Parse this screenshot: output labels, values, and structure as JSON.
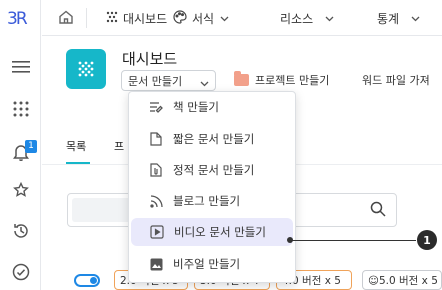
{
  "sidebar": {
    "logo": "3R",
    "notification_count": "1",
    "icons": [
      "menu-icon",
      "apps-grid-icon",
      "bell-icon",
      "star-icon",
      "history-icon",
      "check-circle-icon"
    ]
  },
  "topnav": {
    "items": [
      {
        "label": "대시보드",
        "icon": "dots-grid-icon"
      },
      {
        "label": "서식",
        "icon": "palette-icon"
      },
      {
        "label": "리소스"
      },
      {
        "label": "통계"
      }
    ]
  },
  "header": {
    "title": "대시보드",
    "doc_dropdown_label": "문서 만들기",
    "project_button": "프로젝트 만들기",
    "word_button": "워드 파일 가져"
  },
  "tabs": [
    {
      "label": "목록"
    },
    {
      "label": "프"
    }
  ],
  "menu": {
    "items": [
      {
        "label": "책 만들기",
        "icon": "book-icon"
      },
      {
        "label": "짧은 문서 만들기",
        "icon": "file-icon"
      },
      {
        "label": "정적 문서 만들기",
        "icon": "attachment-file-icon"
      },
      {
        "label": "블로그 만들기",
        "icon": "rss-icon"
      },
      {
        "label": "비디오 문서 만들기",
        "icon": "video-icon"
      },
      {
        "label": "비주얼 만들기",
        "icon": "image-icon"
      }
    ],
    "highlighted_index": 4
  },
  "annotation": {
    "marker": "1"
  },
  "bottom_row": {
    "pills": [
      {
        "label": "2.0 버전 x 5"
      },
      {
        "label": "3.0 버전 x 4"
      },
      {
        "label": "4.0 버전 x 5"
      },
      {
        "label": "☺5.0 버전 x 5"
      }
    ]
  },
  "colors": {
    "accent": "#16b7c9",
    "brand_blue": "#3b5bd9",
    "highlight": "#e9e9fb"
  }
}
